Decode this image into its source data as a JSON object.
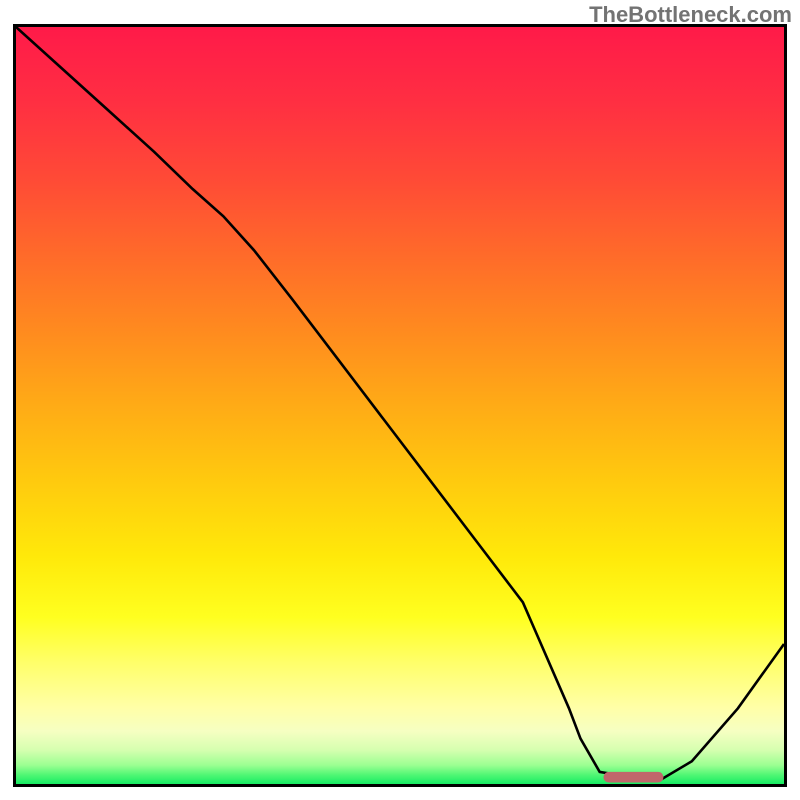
{
  "watermark": "TheBottleneck.com",
  "chart_data": {
    "type": "line",
    "title": "",
    "xlabel": "",
    "ylabel": "",
    "xlim": [
      0,
      100
    ],
    "ylim": [
      0,
      100
    ],
    "grid": false,
    "legend": false,
    "gradient_stops": [
      {
        "offset": 0.0,
        "color": "#ff1a49"
      },
      {
        "offset": 0.1,
        "color": "#ff2f42"
      },
      {
        "offset": 0.2,
        "color": "#ff4a36"
      },
      {
        "offset": 0.3,
        "color": "#ff6a2a"
      },
      {
        "offset": 0.4,
        "color": "#ff8a1f"
      },
      {
        "offset": 0.5,
        "color": "#ffab16"
      },
      {
        "offset": 0.6,
        "color": "#ffca0e"
      },
      {
        "offset": 0.7,
        "color": "#ffe90a"
      },
      {
        "offset": 0.78,
        "color": "#ffff20"
      },
      {
        "offset": 0.84,
        "color": "#ffff6a"
      },
      {
        "offset": 0.9,
        "color": "#ffffa8"
      },
      {
        "offset": 0.93,
        "color": "#f6ffc2"
      },
      {
        "offset": 0.955,
        "color": "#d6ffb0"
      },
      {
        "offset": 0.975,
        "color": "#9cff92"
      },
      {
        "offset": 0.988,
        "color": "#50f774"
      },
      {
        "offset": 1.0,
        "color": "#17ec63"
      }
    ],
    "series": [
      {
        "name": "curve",
        "color": "#000000",
        "x": [
          0.0,
          6.0,
          12.0,
          18.0,
          23.0,
          27.0,
          31.0,
          36.0,
          42.0,
          48.0,
          54.0,
          60.0,
          66.0,
          72.0,
          73.5,
          76.0,
          82.0,
          84.0,
          88.0,
          94.0,
          100.0
        ],
        "y": [
          100.0,
          94.5,
          89.0,
          83.5,
          78.6,
          75.0,
          70.5,
          64.0,
          56.0,
          48.0,
          40.0,
          32.0,
          24.0,
          10.0,
          6.0,
          1.6,
          0.6,
          0.6,
          3.0,
          10.0,
          18.5
        ]
      }
    ],
    "marker": {
      "name": "optimal-band",
      "color": "#c1666b",
      "x_start": 76.5,
      "x_end": 84.3,
      "y": 0.9,
      "thickness_pct": 1.4
    }
  }
}
